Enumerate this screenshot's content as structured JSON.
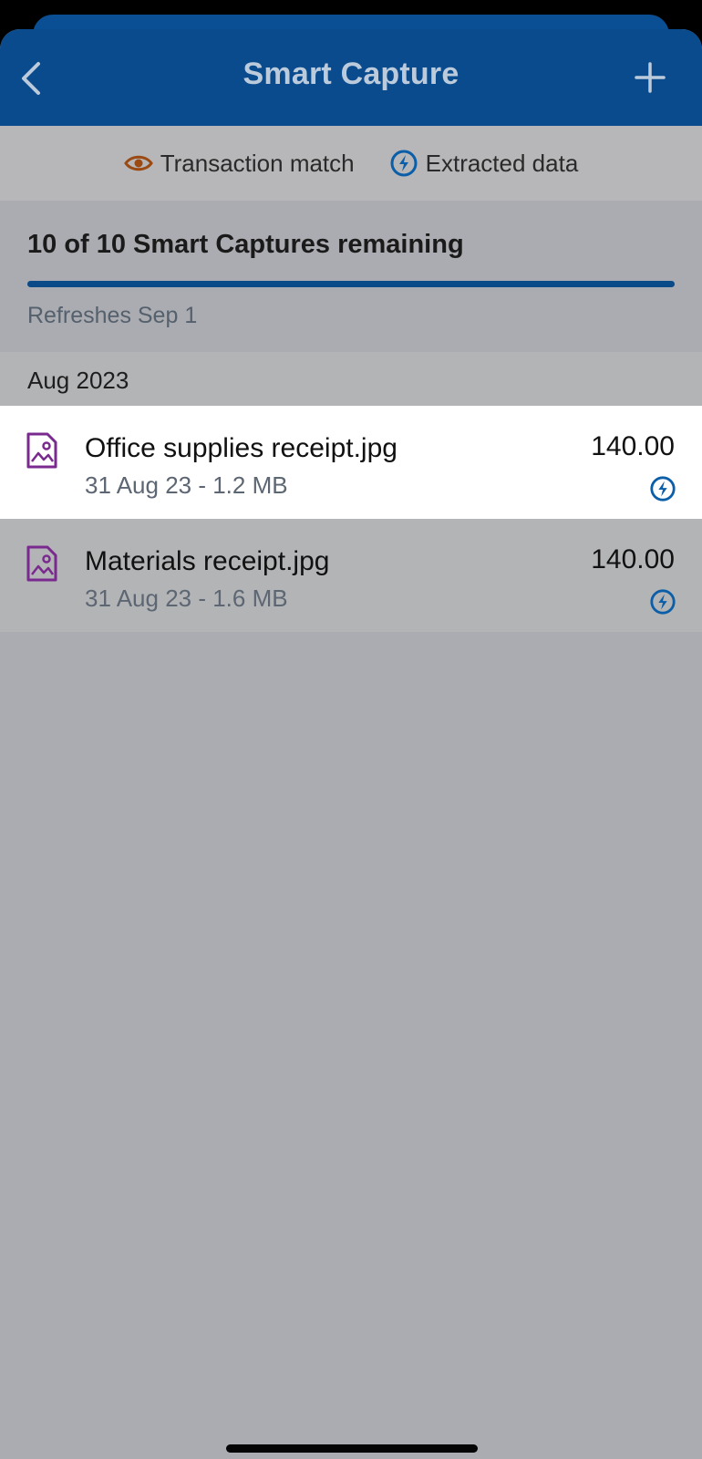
{
  "header": {
    "title": "Smart Capture",
    "back_icon": "chevron-left-icon",
    "add_icon": "plus-icon"
  },
  "legend": {
    "transaction_match": {
      "label": "Transaction match",
      "icon": "eye-icon",
      "color": "#9a4a12"
    },
    "extracted_data": {
      "label": "Extracted data",
      "icon": "lightning-circle-icon",
      "color": "#0b5ea8"
    }
  },
  "summary": {
    "remaining_text": "10 of 10 Smart Captures remaining",
    "remaining_fraction": 1.0,
    "refresh_text": "Refreshes Sep 1"
  },
  "sections": [
    {
      "label": "Aug 2023",
      "items": [
        {
          "name": "Office supplies receipt.jpg",
          "meta": "31 Aug 23 - 1.2 MB",
          "amount": "140.00",
          "status_icon": "lightning-circle-icon",
          "highlighted": true
        },
        {
          "name": "Materials receipt.jpg",
          "meta": "31 Aug 23 - 1.6 MB",
          "amount": "140.00",
          "status_icon": "lightning-circle-icon",
          "highlighted": false
        }
      ]
    }
  ],
  "colors": {
    "header_bg": "#0a4b8d",
    "accent_blue": "#0b5ea8",
    "file_icon": "#7a2a8f",
    "eye_icon": "#9a4a12"
  }
}
